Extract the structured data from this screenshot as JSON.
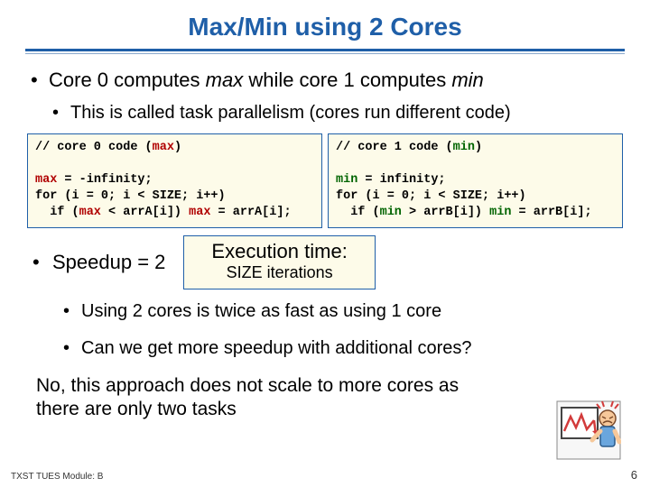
{
  "title": "Max/Min using 2 Cores",
  "bullet_main": {
    "pre": "Core 0 computes ",
    "max": "max",
    "mid": " while core 1 computes ",
    "min": "min"
  },
  "bullet_sub": "This is called task parallelism (cores run different code)",
  "code_left": {
    "c1a": "// core 0 code (",
    "c1b": "max",
    "c1c": ")",
    "l2a": "max",
    "l2b": " = -infinity;",
    "l3": "for (i = 0; i < SIZE; i++)",
    "l4a": "  if (",
    "l4b": "max",
    "l4c": " < arrA[i]) ",
    "l4d": "max",
    "l4e": " = arrA[i];"
  },
  "code_right": {
    "c1a": "// core 1 code (",
    "c1b": "min",
    "c1c": ")",
    "l2a": "min",
    "l2b": " = infinity;",
    "l3": "for (i = 0; i < SIZE; i++)",
    "l4a": "  if (",
    "l4b": "min",
    "l4c": " > arrB[i]) ",
    "l4d": "min",
    "l4e": " = arrB[i];"
  },
  "speedup": "Speedup = 2",
  "exec_title": "Execution time:",
  "exec_sub": "SIZE iterations",
  "sub1": "Using 2 cores is twice as fast as using 1 core",
  "sub2": "Can we get more speedup with additional cores?",
  "answer": "No, this approach does not scale to more cores as there are only two tasks",
  "footer": "TXST TUES Module: B",
  "pagenum": "6",
  "clipart": {
    "frame": "#2a2a2a",
    "paper": "#ffffff",
    "line": "#d23b3b",
    "skin": "#f6c89a",
    "shirt": "#6aa6dd"
  }
}
